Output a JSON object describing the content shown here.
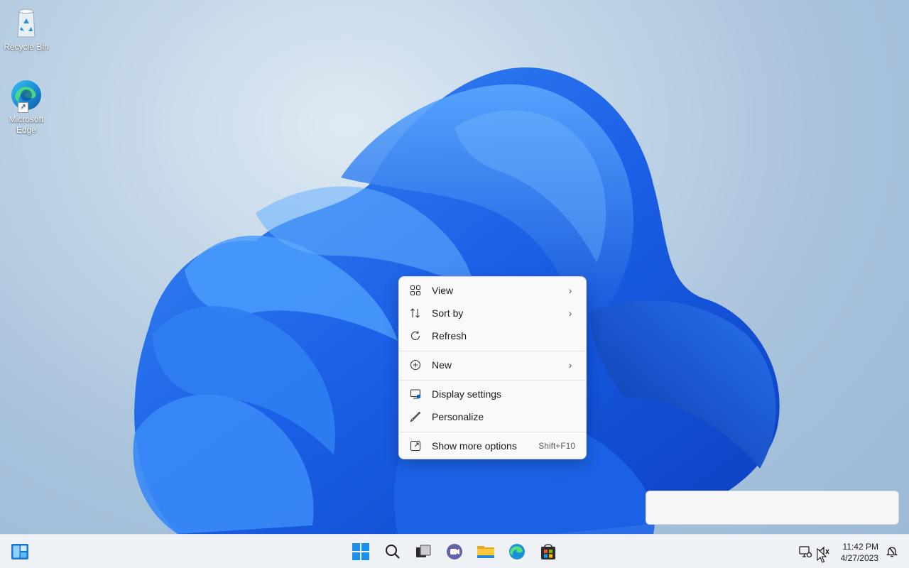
{
  "desktop": {
    "icons": [
      {
        "label": "Recycle Bin"
      },
      {
        "label": "Microsoft\nEdge"
      }
    ]
  },
  "context_menu": {
    "items": [
      {
        "label": "View",
        "icon": "grid-view-icon",
        "submenu": true
      },
      {
        "label": "Sort by",
        "icon": "sort-icon",
        "submenu": true
      },
      {
        "label": "Refresh",
        "icon": "refresh-icon"
      },
      {
        "label": "New",
        "icon": "plus-circle-icon",
        "submenu": true
      },
      {
        "label": "Display settings",
        "icon": "display-settings-icon"
      },
      {
        "label": "Personalize",
        "icon": "brush-icon"
      },
      {
        "label": "Show more options",
        "icon": "more-options-icon",
        "shortcut": "Shift+F10"
      }
    ]
  },
  "taskbar": {
    "apps": [
      "start-icon",
      "search-icon",
      "task-view-icon",
      "teams-chat-icon",
      "file-explorer-icon",
      "edge-icon",
      "store-icon"
    ],
    "clock": {
      "time": "11:42 PM",
      "date": "4/27/2023"
    }
  },
  "colors": {
    "accent": "#0067c0",
    "menu_bg": "#f9f9f9",
    "taskbar_bg": "#eef1f5"
  }
}
